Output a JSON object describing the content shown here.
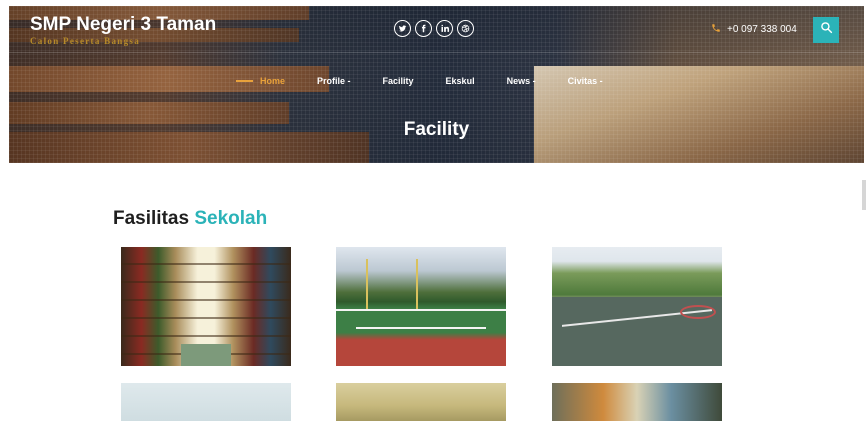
{
  "header": {
    "brand_title": "SMP Negeri 3 Taman",
    "brand_tagline": "Calon Peserta Bangsa",
    "socials": [
      {
        "name": "twitter-icon",
        "glyph": "t"
      },
      {
        "name": "facebook-icon",
        "glyph": "f"
      },
      {
        "name": "linkedin-icon",
        "glyph": "in"
      },
      {
        "name": "dribbble-icon",
        "glyph": "⊛"
      }
    ],
    "phone": "+0 097 338 004",
    "phone_icon": "phone-icon",
    "search_icon": "search-icon",
    "accent_color": "#2bb3b8",
    "nav_active_color": "#e9a23b"
  },
  "nav": {
    "items": [
      {
        "label": "Home"
      },
      {
        "label": "Profile -"
      },
      {
        "label": "Facility"
      },
      {
        "label": "Ekskul"
      },
      {
        "label": "News -"
      },
      {
        "label": "Civitas -"
      }
    ]
  },
  "hero": {
    "title": "Facility"
  },
  "section": {
    "title_main": "Fasilitas",
    "title_accent": "Sekolah"
  }
}
